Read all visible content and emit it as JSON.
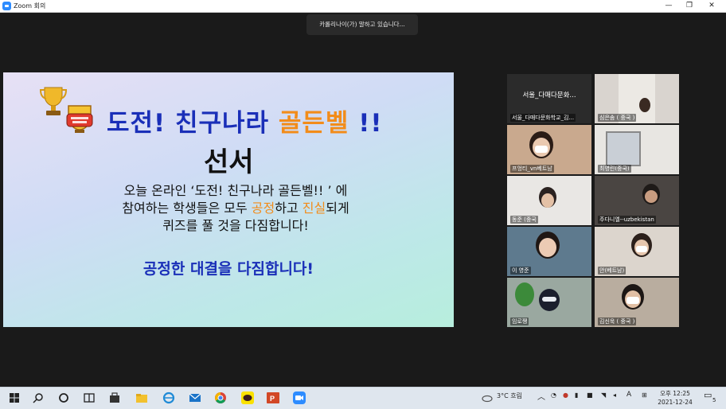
{
  "window": {
    "title": "Zoom 회의",
    "minimize": "—",
    "restore": "❐",
    "close": "✕"
  },
  "speaking": "카롤리나이(가) 말하고 있습니다...",
  "slide": {
    "title_blue": "도전! 친구나라 ",
    "title_orange": "골든벨",
    "title_end": " !!",
    "subtitle": "선서",
    "line1": "오늘 온라인 ‘도전! 친구나라 골든벨!! ’ 에",
    "line2_a": "참여하는 학생들은 모두 ",
    "line2_hl1": "공정",
    "line2_b": "하고 ",
    "line2_hl2": "진실",
    "line2_c": "되게",
    "line3": "퀴즈를 풀 것을 다짐합니다!",
    "pledge": "공정한 대결을 다짐합니다!"
  },
  "participants": [
    {
      "name": "서울_다매다문화학교_김...",
      "big": "서울_다매다문화..."
    },
    {
      "name": "심은솜 ( 중국 )"
    },
    {
      "name": "프엉티_vn베트남"
    },
    {
      "name": "최영린(중국)"
    },
    {
      "name": "동준 (중국"
    },
    {
      "name": "주다니엘--uzbekistan"
    },
    {
      "name": "이 영준"
    },
    {
      "name": "안(베트남)"
    },
    {
      "name": "임로쨍"
    },
    {
      "name": "김신욱 ( 중국 )"
    }
  ],
  "taskbar": {
    "weather": "3°C 흐림",
    "lang": "A",
    "time": "오후 12:25",
    "date": "2021-12-24",
    "notif_count": "5"
  },
  "colors": {
    "accent_blue": "#1a2fb8",
    "accent_orange": "#f28c1a",
    "zoom_blue": "#2d8cff"
  }
}
